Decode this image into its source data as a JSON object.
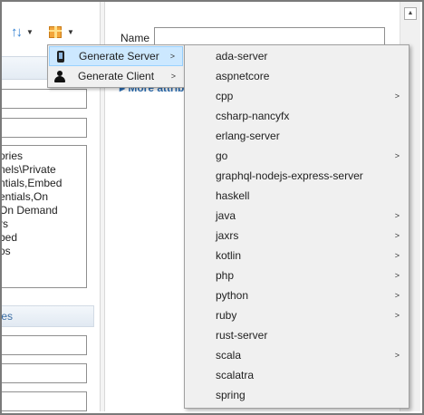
{
  "left_pane": {
    "list_items": [
      "ories",
      "nels\\Private",
      "ntials,Embed",
      "entials,On",
      "On Demand",
      "rs",
      "bed",
      "os"
    ],
    "section_label": "ories"
  },
  "right_pane": {
    "name_label": "Name",
    "more_attributes": "▸ More attrib"
  },
  "context_menu": {
    "items": [
      {
        "label": "Generate Server",
        "icon": "phone-icon",
        "highlighted": true
      },
      {
        "label": "Generate Client",
        "icon": "person-icon",
        "highlighted": false
      }
    ]
  },
  "server_submenu": {
    "items": [
      {
        "label": "ada-server",
        "has_submenu": false
      },
      {
        "label": "aspnetcore",
        "has_submenu": false
      },
      {
        "label": "cpp",
        "has_submenu": true
      },
      {
        "label": "csharp-nancyfx",
        "has_submenu": false
      },
      {
        "label": "erlang-server",
        "has_submenu": false
      },
      {
        "label": "go",
        "has_submenu": true
      },
      {
        "label": "graphql-nodejs-express-server",
        "has_submenu": false
      },
      {
        "label": "haskell",
        "has_submenu": false
      },
      {
        "label": "java",
        "has_submenu": true
      },
      {
        "label": "jaxrs",
        "has_submenu": true
      },
      {
        "label": "kotlin",
        "has_submenu": true
      },
      {
        "label": "php",
        "has_submenu": true
      },
      {
        "label": "python",
        "has_submenu": true
      },
      {
        "label": "ruby",
        "has_submenu": true
      },
      {
        "label": "rust-server",
        "has_submenu": false
      },
      {
        "label": "scala",
        "has_submenu": true
      },
      {
        "label": "scalatra",
        "has_submenu": false
      },
      {
        "label": "spring",
        "has_submenu": false
      }
    ]
  }
}
